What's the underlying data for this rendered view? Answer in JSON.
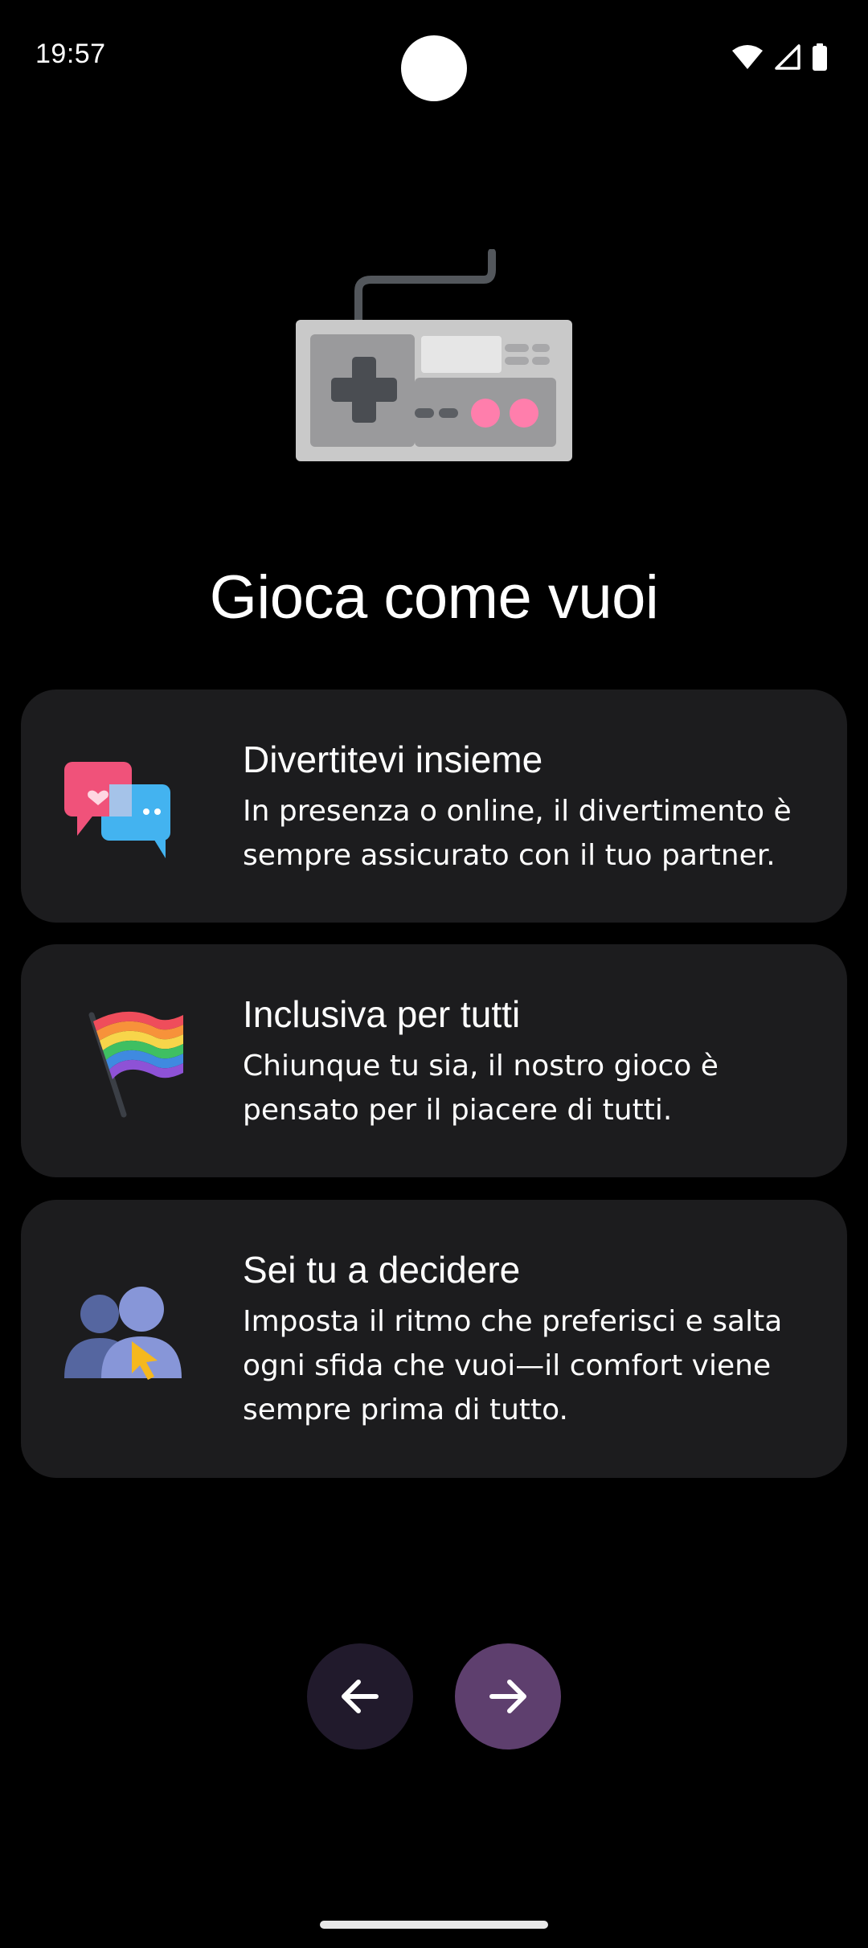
{
  "status_bar": {
    "time": "19:57",
    "icons": [
      "wifi-icon",
      "signal-icon",
      "battery-icon"
    ]
  },
  "hero": {
    "icon": "game-controller-icon"
  },
  "title": "Gioca come vuoi",
  "cards": [
    {
      "icon": "chat-bubbles-icon",
      "title": "Divertitevi insieme",
      "body": "In presenza o online, il divertimento è sempre assicurato con il tuo partner."
    },
    {
      "icon": "rainbow-flag-icon",
      "title": "Inclusiva per tutti",
      "body": "Chiunque tu sia, il nostro gioco è pensato per il piacere di tutti."
    },
    {
      "icon": "users-cursor-icon",
      "title": "Sei tu a decidere",
      "body": "Imposta il ritmo che preferisci e salta ogni sfida che vuoi—il comfort viene sempre prima di tutto."
    }
  ],
  "navigation": {
    "back_icon": "arrow-left-icon",
    "next_icon": "arrow-right-icon",
    "back_color": "#211a2c",
    "next_color": "#5e3f6e"
  },
  "colors": {
    "background": "#000000",
    "card": "#1c1c1e",
    "text": "#ffffff"
  }
}
